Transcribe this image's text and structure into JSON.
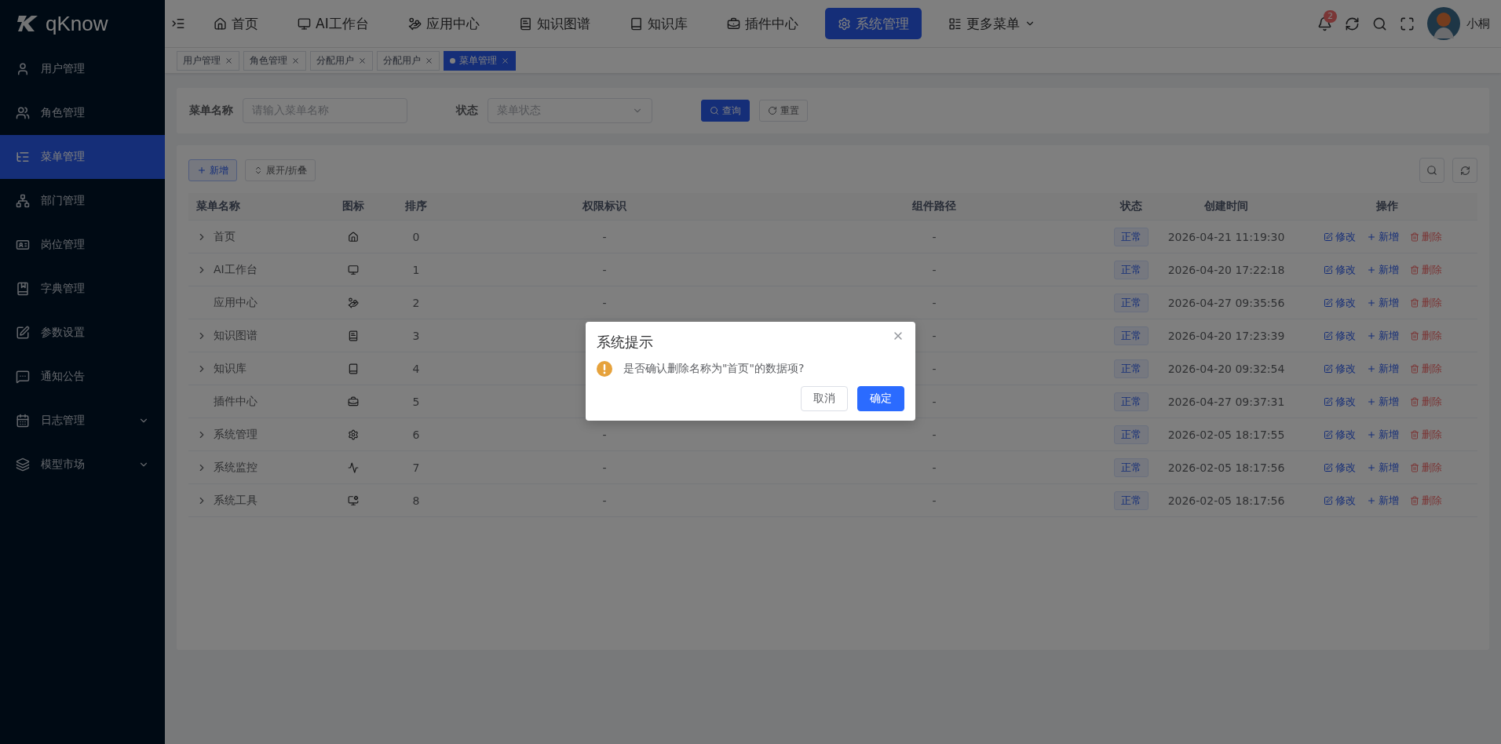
{
  "app": {
    "logo": "qKnow"
  },
  "sidebar": {
    "items": [
      {
        "label": "用户管理",
        "selected": false,
        "expandable": false
      },
      {
        "label": "角色管理",
        "selected": false,
        "expandable": false
      },
      {
        "label": "菜单管理",
        "selected": true,
        "expandable": false
      },
      {
        "label": "部门管理",
        "selected": false,
        "expandable": false
      },
      {
        "label": "岗位管理",
        "selected": false,
        "expandable": false
      },
      {
        "label": "字典管理",
        "selected": false,
        "expandable": false
      },
      {
        "label": "参数设置",
        "selected": false,
        "expandable": false
      },
      {
        "label": "通知公告",
        "selected": false,
        "expandable": false
      },
      {
        "label": "日志管理",
        "selected": false,
        "expandable": true
      },
      {
        "label": "模型市场",
        "selected": false,
        "expandable": true
      }
    ]
  },
  "top_nav": {
    "items": [
      {
        "label": "首页",
        "selected": false,
        "dropdown": false
      },
      {
        "label": "AI工作台",
        "selected": false,
        "dropdown": false
      },
      {
        "label": "应用中心",
        "selected": false,
        "dropdown": false
      },
      {
        "label": "知识图谱",
        "selected": false,
        "dropdown": false
      },
      {
        "label": "知识库",
        "selected": false,
        "dropdown": false
      },
      {
        "label": "插件中心",
        "selected": false,
        "dropdown": false
      },
      {
        "label": "系统管理",
        "selected": true,
        "dropdown": false
      },
      {
        "label": "更多菜单",
        "selected": false,
        "dropdown": true
      }
    ]
  },
  "notifications": {
    "count": "2"
  },
  "user": {
    "name": "小桐"
  },
  "tags": [
    {
      "label": "用户管理",
      "selected": false
    },
    {
      "label": "角色管理",
      "selected": false
    },
    {
      "label": "分配用户",
      "selected": false
    },
    {
      "label": "分配用户",
      "selected": false
    },
    {
      "label": "菜单管理",
      "selected": true
    }
  ],
  "search": {
    "fields": [
      {
        "label": "菜单名称",
        "placeholder": "请输入菜单名称",
        "kind": "text"
      },
      {
        "label": "状态",
        "placeholder": "菜单状态",
        "kind": "select"
      }
    ],
    "buttons": [
      {
        "label": "查询",
        "kind": "primary"
      },
      {
        "label": "重置",
        "kind": "default"
      }
    ]
  },
  "toolbar": {
    "buttons": [
      {
        "label": "新增",
        "kind": "add"
      },
      {
        "label": "展开/折叠",
        "kind": "toggle"
      }
    ]
  },
  "table": {
    "columns": [
      "菜单名称",
      "图标",
      "排序",
      "权限标识",
      "组件路径",
      "状态",
      "创建时间",
      "操作"
    ],
    "rows": [
      {
        "name": "首页",
        "expandable": true,
        "order": "0",
        "perms": "-",
        "component": "-",
        "status": "正常",
        "created": "2026-04-21 11:19:30",
        "actions": [
          {
            "label": "修改",
            "kind": "edit"
          },
          {
            "label": "新增",
            "kind": "add"
          },
          {
            "label": "删除",
            "kind": "delete"
          }
        ]
      },
      {
        "name": "AI工作台",
        "expandable": true,
        "order": "1",
        "perms": "-",
        "component": "-",
        "status": "正常",
        "created": "2026-04-20 17:22:18",
        "actions": [
          {
            "label": "修改",
            "kind": "edit"
          },
          {
            "label": "新增",
            "kind": "add"
          },
          {
            "label": "删除",
            "kind": "delete"
          }
        ]
      },
      {
        "name": "应用中心",
        "expandable": false,
        "order": "2",
        "perms": "-",
        "component": "-",
        "status": "正常",
        "created": "2026-04-27 09:35:56",
        "actions": [
          {
            "label": "修改",
            "kind": "edit"
          },
          {
            "label": "新增",
            "kind": "add"
          },
          {
            "label": "删除",
            "kind": "delete"
          }
        ]
      },
      {
        "name": "知识图谱",
        "expandable": true,
        "order": "3",
        "component": "-",
        "status": "正常",
        "created": "2026-04-20 17:23:39",
        "actions": [
          {
            "label": "修改",
            "kind": "edit"
          },
          {
            "label": "新增",
            "kind": "add"
          },
          {
            "label": "删除",
            "kind": "delete"
          }
        ]
      },
      {
        "name": "知识库",
        "expandable": true,
        "order": "4",
        "component": "-",
        "status": "正常",
        "created": "2026-04-20 09:32:54",
        "actions": [
          {
            "label": "修改",
            "kind": "edit"
          },
          {
            "label": "新增",
            "kind": "add"
          },
          {
            "label": "删除",
            "kind": "delete"
          }
        ]
      },
      {
        "name": "插件中心",
        "expandable": false,
        "order": "5",
        "component": "-",
        "status": "正常",
        "created": "2026-04-27 09:37:31",
        "actions": [
          {
            "label": "修改",
            "kind": "edit"
          },
          {
            "label": "新增",
            "kind": "add"
          },
          {
            "label": "删除",
            "kind": "delete"
          }
        ]
      },
      {
        "name": "系统管理",
        "expandable": true,
        "order": "6",
        "perms": "-",
        "component": "-",
        "status": "正常",
        "created": "2026-02-05 18:17:55",
        "actions": [
          {
            "label": "修改",
            "kind": "edit"
          },
          {
            "label": "新增",
            "kind": "add"
          },
          {
            "label": "删除",
            "kind": "delete"
          }
        ]
      },
      {
        "name": "系统监控",
        "expandable": true,
        "order": "7",
        "perms": "-",
        "component": "-",
        "status": "正常",
        "created": "2026-02-05 18:17:56",
        "actions": [
          {
            "label": "修改",
            "kind": "edit"
          },
          {
            "label": "新增",
            "kind": "add"
          },
          {
            "label": "删除",
            "kind": "delete"
          }
        ]
      },
      {
        "name": "系统工具",
        "expandable": true,
        "order": "8",
        "perms": "-",
        "component": "-",
        "status": "正常",
        "created": "2026-02-05 18:17:56",
        "actions": [
          {
            "label": "修改",
            "kind": "edit"
          },
          {
            "label": "新增",
            "kind": "add"
          },
          {
            "label": "删除",
            "kind": "delete"
          }
        ]
      }
    ]
  },
  "dialog": {
    "title": "系统提示",
    "message": "是否确认删除名称为\"首页\"的数据项?",
    "buttons": [
      {
        "label": "取消",
        "kind": "default"
      },
      {
        "label": "确定",
        "kind": "primary"
      }
    ]
  }
}
